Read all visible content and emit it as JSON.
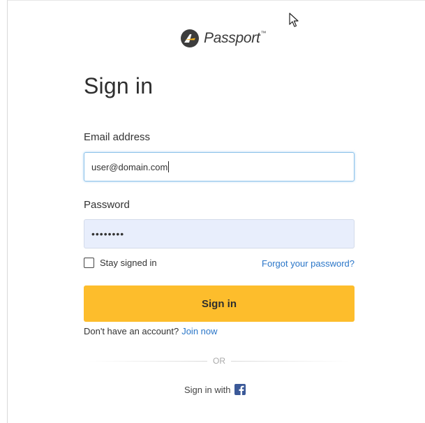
{
  "brand": {
    "name": "Passport",
    "tm": "™",
    "logo_icon": "passport-logo-icon"
  },
  "form": {
    "title": "Sign in",
    "email_label": "Email address",
    "email_value": "user@domain.com",
    "password_label": "Password",
    "password_value": "••••••••",
    "stay_signed_in": "Stay signed in",
    "stay_signed_in_checked": false,
    "forgot_password": "Forgot your password?",
    "submit_label": "Sign in",
    "no_account_text": "Don't have an account?",
    "join_link": "Join now",
    "divider_text": "OR",
    "social_text": "Sign in with",
    "social_icon": "facebook-icon"
  },
  "colors": {
    "button": "#fdbd2c",
    "link": "#2a76c8",
    "focus_border": "#8ec3ea",
    "autofill_bg": "#e8eefc",
    "facebook": "#3b5998"
  }
}
